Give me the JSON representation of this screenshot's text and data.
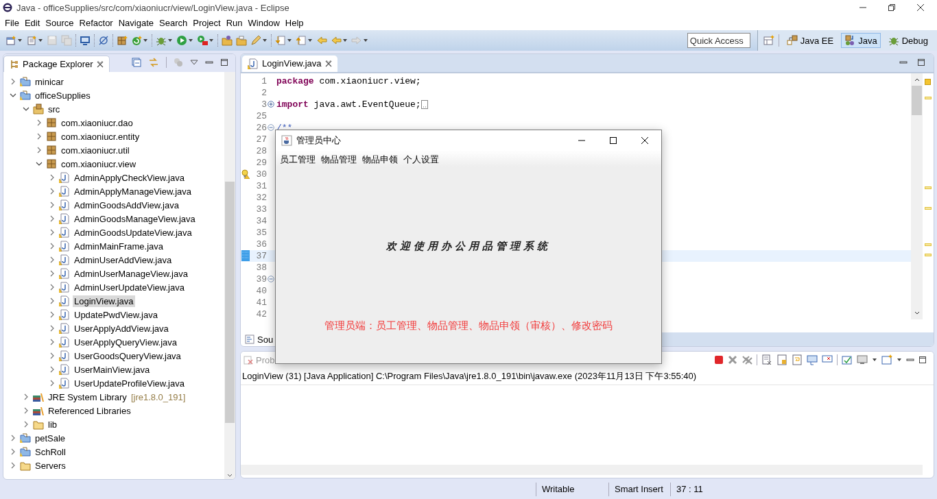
{
  "window": {
    "title": "Java - officeSupplies/src/com/xiaoniucr/view/LoginView.java - Eclipse"
  },
  "menu": [
    "File",
    "Edit",
    "Source",
    "Refactor",
    "Navigate",
    "Search",
    "Project",
    "Run",
    "Window",
    "Help"
  ],
  "quick_access": {
    "placeholder": "Quick Access"
  },
  "perspectives": [
    {
      "label": "Java EE",
      "selected": false
    },
    {
      "label": "Java",
      "selected": true
    },
    {
      "label": "Debug",
      "selected": false
    }
  ],
  "package_explorer": {
    "title": "Package Explorer",
    "tree": [
      {
        "label": "minicar",
        "kind": "project",
        "expanded": false,
        "selected": false
      },
      {
        "label": "officeSupplies",
        "kind": "project",
        "expanded": true,
        "selected": false,
        "children": [
          {
            "label": "src",
            "kind": "source-folder",
            "expanded": true,
            "selected": false,
            "children": [
              {
                "label": "com.xiaoniucr.dao",
                "kind": "package",
                "expanded": false,
                "selected": false
              },
              {
                "label": "com.xiaoniucr.entity",
                "kind": "package",
                "expanded": false,
                "selected": false
              },
              {
                "label": "com.xiaoniucr.util",
                "kind": "package",
                "expanded": false,
                "selected": false
              },
              {
                "label": "com.xiaoniucr.view",
                "kind": "package",
                "expanded": true,
                "selected": false,
                "children": [
                  {
                    "label": "AdminApplyCheckView.java",
                    "kind": "file",
                    "expanded": false,
                    "selected": false
                  },
                  {
                    "label": "AdminApplyManageView.java",
                    "kind": "file",
                    "expanded": false,
                    "selected": false
                  },
                  {
                    "label": "AdminGoodsAddView.java",
                    "kind": "file",
                    "expanded": false,
                    "selected": false
                  },
                  {
                    "label": "AdminGoodsManageView.java",
                    "kind": "file",
                    "expanded": false,
                    "selected": false
                  },
                  {
                    "label": "AdminGoodsUpdateView.java",
                    "kind": "file",
                    "expanded": false,
                    "selected": false
                  },
                  {
                    "label": "AdminMainFrame.java",
                    "kind": "file",
                    "expanded": false,
                    "selected": false
                  },
                  {
                    "label": "AdminUserAddView.java",
                    "kind": "file",
                    "expanded": false,
                    "selected": false
                  },
                  {
                    "label": "AdminUserManageView.java",
                    "kind": "file",
                    "expanded": false,
                    "selected": false
                  },
                  {
                    "label": "AdminUserUpdateView.java",
                    "kind": "file",
                    "expanded": false,
                    "selected": false
                  },
                  {
                    "label": "LoginView.java",
                    "kind": "file",
                    "expanded": false,
                    "selected": true
                  },
                  {
                    "label": "UpdatePwdView.java",
                    "kind": "file",
                    "expanded": false,
                    "selected": false
                  },
                  {
                    "label": "UserApplyAddView.java",
                    "kind": "file",
                    "expanded": false,
                    "selected": false
                  },
                  {
                    "label": "UserApplyQueryView.java",
                    "kind": "file",
                    "expanded": false,
                    "selected": false
                  },
                  {
                    "label": "UserGoodsQueryView.java",
                    "kind": "file",
                    "expanded": false,
                    "selected": false
                  },
                  {
                    "label": "UserMainView.java",
                    "kind": "file",
                    "expanded": false,
                    "selected": false
                  },
                  {
                    "label": "UserUpdateProfileView.java",
                    "kind": "file",
                    "expanded": false,
                    "selected": false
                  }
                ]
              }
            ]
          },
          {
            "label": "JRE System Library",
            "decoration": "[jre1.8.0_191]",
            "kind": "library",
            "expanded": false,
            "selected": false
          },
          {
            "label": "Referenced Libraries",
            "kind": "library",
            "expanded": false,
            "selected": false
          },
          {
            "label": "lib",
            "kind": "folder",
            "expanded": false,
            "selected": false
          }
        ]
      },
      {
        "label": "petSale",
        "kind": "project",
        "expanded": false,
        "selected": false
      },
      {
        "label": "SchRoll",
        "kind": "project",
        "expanded": false,
        "selected": false
      },
      {
        "label": "Servers",
        "kind": "folder",
        "expanded": false,
        "selected": false
      }
    ]
  },
  "editor": {
    "tabs": [
      {
        "label": "LoginView.java",
        "selected": true
      }
    ],
    "lines": [
      {
        "number": "1",
        "code": [
          {
            "kind": "keyword",
            "text": "package"
          },
          {
            "kind": "plain",
            "text": " com.xiaoniucr.view;"
          }
        ]
      },
      {
        "number": "2"
      },
      {
        "number": "3",
        "foldable": true,
        "folded": true,
        "code": [
          {
            "kind": "keyword",
            "text": "import"
          },
          {
            "kind": "plain",
            "text": " java.awt.EventQueue;"
          }
        ]
      },
      {
        "number": "25"
      },
      {
        "number": "26",
        "foldable": true,
        "folded": false,
        "code": [
          {
            "kind": "comment",
            "text": "/**"
          }
        ]
      },
      {
        "number": "27"
      },
      {
        "number": "28"
      },
      {
        "number": "29"
      },
      {
        "number": "30",
        "warning": true
      },
      {
        "number": "31"
      },
      {
        "number": "32"
      },
      {
        "number": "33"
      },
      {
        "number": "34"
      },
      {
        "number": "35"
      },
      {
        "number": "36"
      },
      {
        "number": "37",
        "current": true
      },
      {
        "number": "38"
      },
      {
        "number": "39",
        "foldable": true,
        "folded": false
      },
      {
        "number": "40"
      },
      {
        "number": "41"
      },
      {
        "number": "42"
      }
    ],
    "bottom_tabs": [
      {
        "label": "Sou",
        "selected": true
      }
    ]
  },
  "console": {
    "tabs": [
      {
        "label": "Prob",
        "selected": false
      }
    ],
    "header": "LoginView (31) [Java Application] C:\\Program Files\\Java\\jre1.8.0_191\\bin\\javaw.exe (2023年11月13日 下午3:55:40)"
  },
  "status_bar": [
    "Writable",
    "Smart Insert",
    "37 : 11"
  ],
  "dialog": {
    "title": "管理员中心",
    "menu": [
      "员工管理",
      "物品管理",
      "物品申领",
      "个人设置"
    ],
    "heading": "欢迎使用办公用品管理系统",
    "note": "管理员端：员工管理、物品管理、物品申领（审核）、修改密码"
  }
}
